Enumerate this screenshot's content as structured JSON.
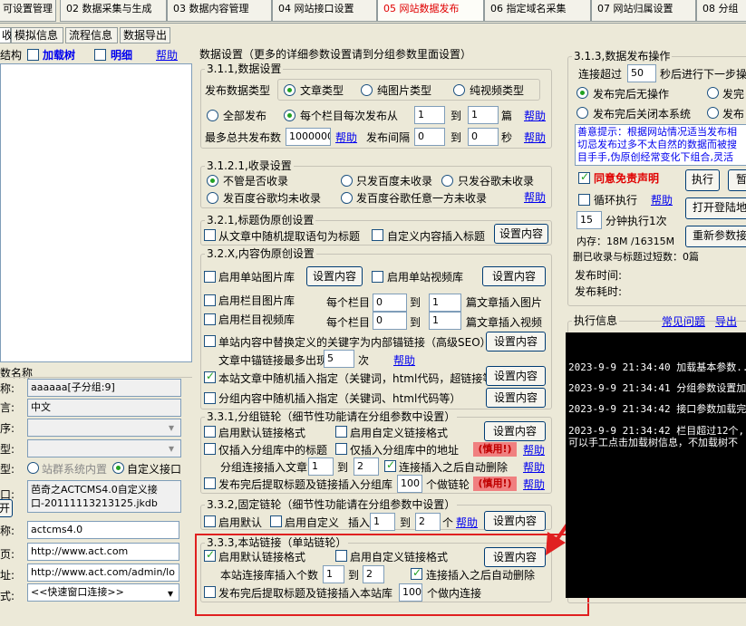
{
  "top_tabs": [
    {
      "label": "可设置管理"
    },
    {
      "label": "02 数据采集与生成"
    },
    {
      "label": "03 数据内容管理"
    },
    {
      "label": "04 网站接口设置"
    },
    {
      "label": "05 网站数据发布"
    },
    {
      "label": "06 指定域名采集"
    },
    {
      "label": "07 网站归属设置"
    },
    {
      "label": "08 分组"
    }
  ],
  "sub_tabs": [
    {
      "label": "收"
    },
    {
      "label": "模拟信息"
    },
    {
      "label": "流程信息"
    },
    {
      "label": "数据导出"
    }
  ],
  "left_panel": {
    "title_struct": "结构",
    "load_tree": "加载树",
    "detail": "明细",
    "help": "帮助",
    "section_title": "数名称",
    "rows": [
      {
        "label": "称:",
        "value": "aaaaaa[子分组:9]"
      },
      {
        "label": "言:",
        "value": "中文"
      },
      {
        "label": "序:",
        "value": ""
      },
      {
        "label": "型:",
        "value": ""
      }
    ],
    "type_label": "型:",
    "radio_site": "站群系统内置",
    "radio_custom": "自定义接口",
    "port_label": "口:",
    "port_value_1": "芭奇之ACTCMS4.0自定义接",
    "port_value_2": "口-20111113213125.jkdb",
    "open_btn": "开",
    "name_label": "称:",
    "name_value": "actcms4.0",
    "home_label": "页:",
    "home_value": "http://www.act.com",
    "addr_label": "址:",
    "addr_value": "http://www.act.com/admin/lo",
    "mode_label": "式:",
    "mode_value": "<<快速窗口连接>>"
  },
  "main": {
    "title": "数据设置（更多的详细参数设置请到分组参数里面设置）",
    "g311": {
      "title": "3.1.1,数据设置",
      "type_label": "发布数据类型",
      "opt_article": "文章类型",
      "opt_image": "纯图片类型",
      "opt_video": "纯视频类型",
      "publish_all": "全部发布",
      "per_column": "每个栏目每次发布从",
      "from": "1",
      "to_label": "到",
      "to": "1",
      "unit_pieces": "篇",
      "help": "帮助",
      "max_label": "最多总共发布数",
      "max_value": "1000000",
      "interval_label": "发布间隔",
      "interval_from": "0",
      "interval_to": "0",
      "unit_sec": "秒"
    },
    "g3121": {
      "title": "3.1.2.1,收录设置",
      "opt_any": "不管是否收录",
      "opt_baidu_no": "只发百度未收录",
      "opt_google_no": "只发谷歌未收录",
      "opt_both_no": "发百度谷歌均未收录",
      "opt_either_no": "发百度谷歌任意一方未收录",
      "help": "帮助"
    },
    "g321": {
      "title": "3.2.1,标题伪原创设置",
      "opt_random": "从文章中随机提取语句为标题",
      "opt_custom": "自定义内容插入标题",
      "btn": "设置内容"
    },
    "g32x": {
      "title": "3.2.X,内容伪原创设置",
      "site_image": "启用单站图片库",
      "set_btn": "设置内容",
      "site_video": "启用单站视频库",
      "col_image": "启用栏目图片库",
      "col_video": "启用栏目视频库",
      "per_col": "每个栏目",
      "img_from": "0",
      "img_to": "1",
      "img_suffix": "篇文章插入图片",
      "vid_from": "0",
      "vid_to": "1",
      "vid_suffix": "篇文章插入视频",
      "replace_kw": "单站内容中替换定义的关键字为内部锚链接（高级SEO）",
      "anchor_max_label": "文章中锚链接最多出现",
      "anchor_max": "5",
      "anchor_unit": "次",
      "help": "帮助",
      "site_random": "本站文章中随机插入指定（关键词，html代码，超链接等）",
      "group_random": "分组内容中随机插入指定（关键词、html代码等）"
    },
    "g331": {
      "title": "3.3.1,分组链轮（细节性功能请在分组参数中设置）",
      "enable_default": "启用默认链接格式",
      "enable_custom": "启用自定义链接格式",
      "btn": "设置内容",
      "only_title": "仅插入分组库中的标题",
      "only_addr": "仅插入分组库中的地址",
      "caution": "(慎用!)",
      "help": "帮助",
      "insert_label": "分组连接插入文章",
      "from": "1",
      "to": "2",
      "auto_delete": "连接插入之后自动删除",
      "extract": "发布完后提取标题及链接插入分组库",
      "count": "100",
      "count_label": "个做链轮"
    },
    "g332": {
      "title": "3.3.2,固定链轮（细节性功能请在分组参数中设置）",
      "enable_default": "启用默认",
      "enable_custom": "启用自定义",
      "insert": "插入",
      "from": "1",
      "to": "2",
      "unit": "个",
      "help": "帮助",
      "btn": "设置内容"
    },
    "g333": {
      "title": "3.3.3,本站链接（单站链轮）",
      "enable_default": "启用默认链接格式",
      "enable_custom": "启用自定义链接格式",
      "btn": "设置内容",
      "insert_label": "本站连接库插入个数",
      "from": "1",
      "to": "2",
      "auto_delete": "连接插入之后自动删除",
      "extract": "发布完后提取标题及链接插入本站库",
      "count": "100",
      "count_label": "个做内连接"
    }
  },
  "right": {
    "g313": {
      "title": "3.1.3,数据发布操作",
      "timeout_label": "连接超过",
      "timeout": "50",
      "timeout_suffix": "秒后进行下一步操",
      "opt_no_action": "发布完后无操作",
      "opt_pub2": "发完",
      "opt_close": "发布完后关闭本系统",
      "opt_pub3": "发布",
      "notice_1": "善意提示：根据网站情况适当发布相",
      "notice_2": "切忌发布过多不太自然的数据而被搜",
      "notice_3": "目手手,伪原创经常变化下组合,灵活",
      "agree": "同意免责声明",
      "exec_btn": "执行",
      "pause_btn": "暂",
      "loop": "循环执行",
      "help": "帮助",
      "open_login": "打开登陆地",
      "loop_minutes": "15",
      "loop_suffix": "分钟执行1次",
      "reload": "重新参数接",
      "memory": "内存：18M /16315M",
      "deleted": "删已收录与标题过短数：0篇",
      "pub_time": "发布时间:",
      "pub_cost": "发布耗时:"
    },
    "exec": {
      "title": "执行信息",
      "faq": "常见问题",
      "export": "导出",
      "lines": [
        "2023-9-9 21:34:40  加载基本参数...",
        "2023-9-9 21:34:41  分组参数设置加",
        "2023-9-9 21:34:42  接口参数加载完",
        "2023-9-9 21:34:42  栏目超过12个,",
        "可以手工点击加载树信息，不加载树不"
      ]
    }
  },
  "colors": {
    "accent_red": "#e00000",
    "link_blue": "#0000ee",
    "check_green": "#21a121",
    "highlight_box": "#e02020",
    "arrow": "#e02020"
  }
}
